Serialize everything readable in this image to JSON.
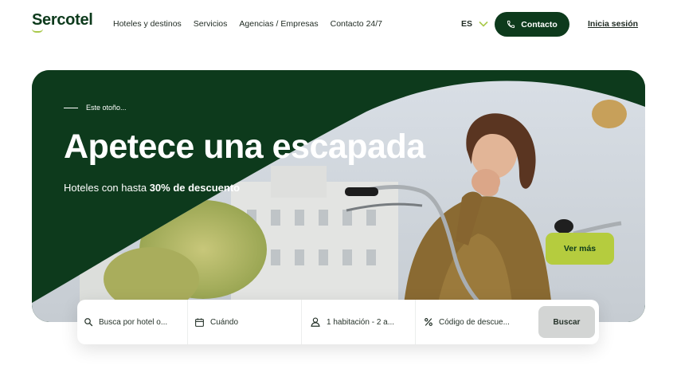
{
  "brand": {
    "name": "Sercotel"
  },
  "nav": {
    "items": [
      {
        "label": "Hoteles y destinos"
      },
      {
        "label": "Servicios"
      },
      {
        "label": "Agencias / Empresas"
      },
      {
        "label": "Contacto 24/7"
      }
    ],
    "language": "ES",
    "contact_label": "Contacto",
    "login_label": "Inicia sesión"
  },
  "hero": {
    "eyebrow": "Este otoño...",
    "title": "Apetece una escapada",
    "subtitle_prefix": "Hoteles con hasta ",
    "subtitle_bold": "30% de descuento",
    "cta_label": "Ver más"
  },
  "search": {
    "hotel_placeholder": "Busca por hotel o...",
    "dates_placeholder": "Cuándo",
    "rooms_value": "1 habitación - 2 a...",
    "promo_placeholder": "Código de descue...",
    "submit_label": "Buscar"
  },
  "colors": {
    "brand_green": "#0d3a1c",
    "accent_lime": "#b5cc3e",
    "button_grey": "#d3d5d4"
  },
  "icons": {
    "phone": "phone-icon",
    "chevron": "chevron-down-icon",
    "search": "search-icon",
    "calendar": "calendar-icon",
    "guests": "person-icon",
    "discount": "percent-icon"
  }
}
